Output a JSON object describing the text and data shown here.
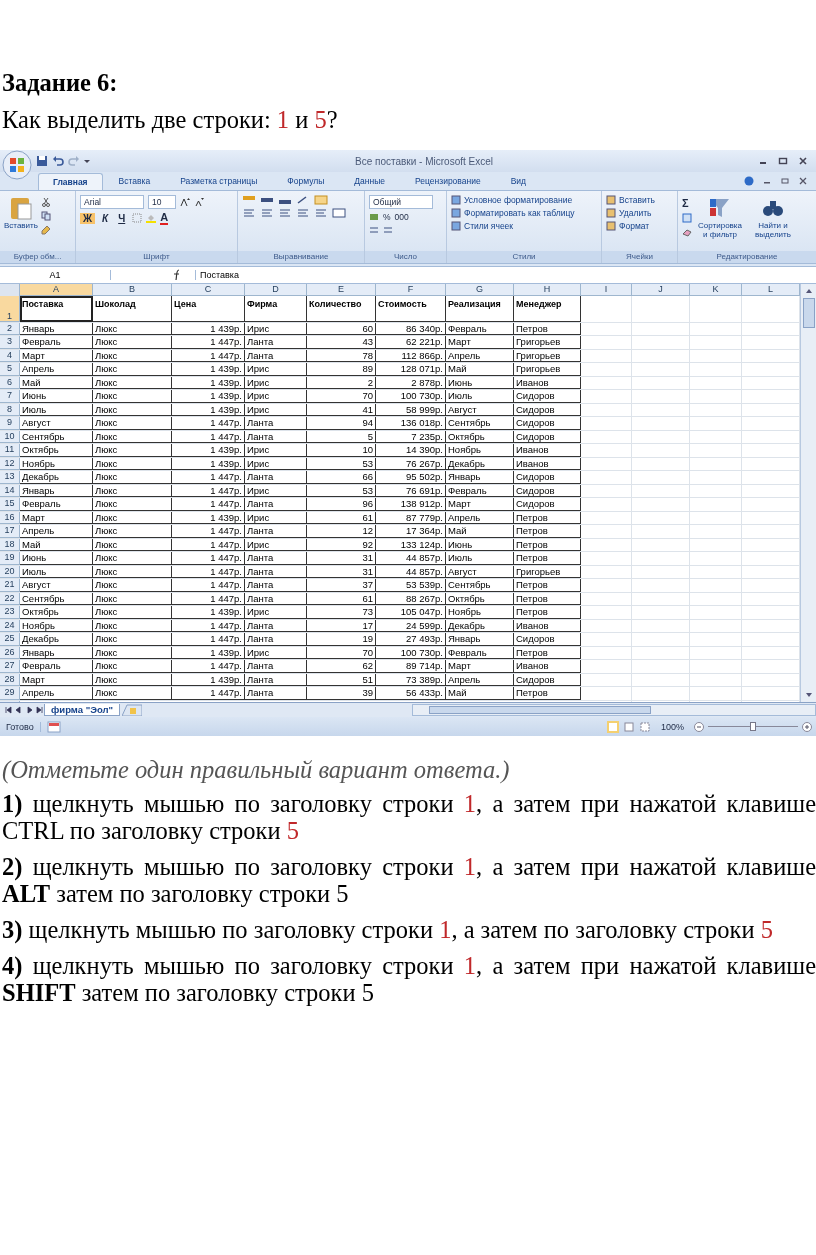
{
  "task": {
    "title": "Задание 6:",
    "question": [
      {
        "text": "Как выделить две строки: ",
        "accent": false
      },
      {
        "text": "1",
        "accent": true
      },
      {
        "text": " и ",
        "accent": false
      },
      {
        "text": "5",
        "accent": true
      },
      {
        "text": "?",
        "accent": false
      }
    ]
  },
  "excel": {
    "title": "Все поставки - Microsoft Excel",
    "tabs": [
      {
        "label": "Главная",
        "selected": true
      },
      {
        "label": "Вставка",
        "selected": false
      },
      {
        "label": "Разметка страницы",
        "selected": false
      },
      {
        "label": "Формулы",
        "selected": false
      },
      {
        "label": "Данные",
        "selected": false
      },
      {
        "label": "Рецензирование",
        "selected": false
      },
      {
        "label": "Вид",
        "selected": false
      }
    ],
    "ribbon": [
      {
        "kind": "clipboard",
        "label": "Буфер обм...",
        "paste": "Вставить"
      },
      {
        "kind": "font",
        "label": "Шрифт",
        "font": "Arial",
        "size": "10",
        "styles": [
          "Ж",
          "К",
          "Ч"
        ],
        "font_color": "A"
      },
      {
        "kind": "alignment",
        "label": "Выравнивание"
      },
      {
        "kind": "number",
        "label": "Число",
        "format": "Общий",
        "percent": "%",
        "thousands": "000"
      },
      {
        "kind": "styles",
        "label": "Стили",
        "items": [
          "Условное форматирование",
          "Форматировать как таблицу",
          "Стили ячеек"
        ]
      },
      {
        "kind": "cells",
        "label": "Ячейки",
        "items": [
          "Вставить",
          "Удалить",
          "Формат"
        ]
      },
      {
        "kind": "editing",
        "label": "Редактирование",
        "sum": "Σ",
        "sort": "Сортировка и фильтр",
        "find": "Найти и выделить"
      }
    ],
    "name_box": "A1",
    "formula": "Поставка",
    "columns": [
      {
        "letter": "A",
        "kind": "text",
        "selected": true
      },
      {
        "letter": "B",
        "kind": "text",
        "selected": false
      },
      {
        "letter": "C",
        "kind": "number",
        "selected": false
      },
      {
        "letter": "D",
        "kind": "text",
        "selected": false
      },
      {
        "letter": "E",
        "kind": "number",
        "selected": false
      },
      {
        "letter": "F",
        "kind": "number",
        "selected": false
      },
      {
        "letter": "G",
        "kind": "text",
        "selected": false
      },
      {
        "letter": "H",
        "kind": "text",
        "selected": false
      },
      {
        "letter": "I",
        "selected": false
      },
      {
        "letter": "J",
        "selected": false
      },
      {
        "letter": "K",
        "selected": false
      },
      {
        "letter": "L",
        "selected": false
      }
    ],
    "header_row": {
      "num": "1",
      "selected": true,
      "cells": [
        "Поставка",
        "Шоколад",
        "Цена",
        "Фирма",
        "Количество",
        "Стоимость",
        "Реализация",
        "Менеджер"
      ]
    },
    "rows": [
      {
        "num": "2",
        "cells": [
          "Январь",
          "Люкс",
          "1 439р.",
          "Ирис",
          "60",
          "86 340р.",
          "Февраль",
          "Петров"
        ]
      },
      {
        "num": "3",
        "cells": [
          "Февраль",
          "Люкс",
          "1 447р.",
          "Ланта",
          "43",
          "62 221р.",
          "Март",
          "Григорьев"
        ]
      },
      {
        "num": "4",
        "cells": [
          "Март",
          "Люкс",
          "1 447р.",
          "Ланта",
          "78",
          "112 866р.",
          "Апрель",
          "Григорьев"
        ]
      },
      {
        "num": "5",
        "cells": [
          "Апрель",
          "Люкс",
          "1 439р.",
          "Ирис",
          "89",
          "128 071р.",
          "Май",
          "Григорьев"
        ]
      },
      {
        "num": "6",
        "cells": [
          "Май",
          "Люкс",
          "1 439р.",
          "Ирис",
          "2",
          "2 878р.",
          "Июнь",
          "Иванов"
        ]
      },
      {
        "num": "7",
        "cells": [
          "Июнь",
          "Люкс",
          "1 439р.",
          "Ирис",
          "70",
          "100 730р.",
          "Июль",
          "Сидоров"
        ]
      },
      {
        "num": "8",
        "cells": [
          "Июль",
          "Люкс",
          "1 439р.",
          "Ирис",
          "41",
          "58 999р.",
          "Август",
          "Сидоров"
        ]
      },
      {
        "num": "9",
        "cells": [
          "Август",
          "Люкс",
          "1 447р.",
          "Ланта",
          "94",
          "136 018р.",
          "Сентябрь",
          "Сидоров"
        ]
      },
      {
        "num": "10",
        "cells": [
          "Сентябрь",
          "Люкс",
          "1 447р.",
          "Ланта",
          "5",
          "7 235р.",
          "Октябрь",
          "Сидоров"
        ]
      },
      {
        "num": "11",
        "cells": [
          "Октябрь",
          "Люкс",
          "1 439р.",
          "Ирис",
          "10",
          "14 390р.",
          "Ноябрь",
          "Иванов"
        ]
      },
      {
        "num": "12",
        "cells": [
          "Ноябрь",
          "Люкс",
          "1 439р.",
          "Ирис",
          "53",
          "76 267р.",
          "Декабрь",
          "Иванов"
        ]
      },
      {
        "num": "13",
        "cells": [
          "Декабрь",
          "Люкс",
          "1 447р.",
          "Ланта",
          "66",
          "95 502р.",
          "Январь",
          "Сидоров"
        ]
      },
      {
        "num": "14",
        "cells": [
          "Январь",
          "Люкс",
          "1 447р.",
          "Ирис",
          "53",
          "76 691р.",
          "Февраль",
          "Сидоров"
        ]
      },
      {
        "num": "15",
        "cells": [
          "Февраль",
          "Люкс",
          "1 447р.",
          "Ланта",
          "96",
          "138 912р.",
          "Март",
          "Сидоров"
        ]
      },
      {
        "num": "16",
        "cells": [
          "Март",
          "Люкс",
          "1 439р.",
          "Ирис",
          "61",
          "87 779р.",
          "Апрель",
          "Петров"
        ]
      },
      {
        "num": "17",
        "cells": [
          "Апрель",
          "Люкс",
          "1 447р.",
          "Ланта",
          "12",
          "17 364р.",
          "Май",
          "Петров"
        ]
      },
      {
        "num": "18",
        "cells": [
          "Май",
          "Люкс",
          "1 447р.",
          "Ирис",
          "92",
          "133 124р.",
          "Июнь",
          "Петров"
        ]
      },
      {
        "num": "19",
        "cells": [
          "Июнь",
          "Люкс",
          "1 447р.",
          "Ланта",
          "31",
          "44 857р.",
          "Июль",
          "Петров"
        ]
      },
      {
        "num": "20",
        "cells": [
          "Июль",
          "Люкс",
          "1 447р.",
          "Ланта",
          "31",
          "44 857р.",
          "Август",
          "Григорьев"
        ]
      },
      {
        "num": "21",
        "cells": [
          "Август",
          "Люкс",
          "1 447р.",
          "Ланта",
          "37",
          "53 539р.",
          "Сентябрь",
          "Петров"
        ]
      },
      {
        "num": "22",
        "cells": [
          "Сентябрь",
          "Люкс",
          "1 447р.",
          "Ланта",
          "61",
          "88 267р.",
          "Октябрь",
          "Петров"
        ]
      },
      {
        "num": "23",
        "cells": [
          "Октябрь",
          "Люкс",
          "1 439р.",
          "Ирис",
          "73",
          "105 047р.",
          "Ноябрь",
          "Петров"
        ]
      },
      {
        "num": "24",
        "cells": [
          "Ноябрь",
          "Люкс",
          "1 447р.",
          "Ланта",
          "17",
          "24 599р.",
          "Декабрь",
          "Иванов"
        ]
      },
      {
        "num": "25",
        "cells": [
          "Декабрь",
          "Люкс",
          "1 447р.",
          "Ланта",
          "19",
          "27 493р.",
          "Январь",
          "Сидоров"
        ]
      },
      {
        "num": "26",
        "cells": [
          "Январь",
          "Люкс",
          "1 439р.",
          "Ирис",
          "70",
          "100 730р.",
          "Февраль",
          "Петров"
        ]
      },
      {
        "num": "27",
        "cells": [
          "Февраль",
          "Люкс",
          "1 447р.",
          "Ланта",
          "62",
          "89 714р.",
          "Март",
          "Иванов"
        ]
      },
      {
        "num": "28",
        "cells": [
          "Март",
          "Люкс",
          "1 439р.",
          "Ланта",
          "51",
          "73 389р.",
          "Апрель",
          "Сидоров"
        ]
      },
      {
        "num": "29",
        "cells": [
          "Апрель",
          "Люкс",
          "1 447р.",
          "Ланта",
          "39",
          "56 433р.",
          "Май",
          "Петров"
        ]
      }
    ],
    "sheet_tab": "фирма \"Эол\"",
    "status": "Готово",
    "zoom": "100%",
    "zoom_slider": {
      "level": 0.5
    }
  },
  "instruction": "(Отметьте один правильный вариант ответа.)",
  "answers": [
    {
      "number": "1)",
      "parts": [
        {
          "text": "щелкнуть мышью по заголовку строки ",
          "accent": false
        },
        {
          "text": "1",
          "accent": true
        },
        {
          "text": ", а затем при нажатой клавише CTRL по заголовку строки ",
          "accent": false
        },
        {
          "text": "5",
          "accent": true
        }
      ]
    },
    {
      "number": "2)",
      "parts": [
        {
          "text": "щелкнуть мышью по заголовку строки ",
          "accent": false
        },
        {
          "text": "1",
          "accent": true
        },
        {
          "text": ", а затем при нажатой клавише **ALT** затем по заголовку строки 5",
          "accent": false
        }
      ]
    },
    {
      "number": "3)",
      "parts": [
        {
          "text": "щелкнуть мышью по заголовку строки ",
          "accent": false
        },
        {
          "text": "1",
          "accent": true
        },
        {
          "text": ", а затем по заголовку строки ",
          "accent": false
        },
        {
          "text": "5",
          "accent": true
        }
      ]
    },
    {
      "number": "4)",
      "parts": [
        {
          "text": "щелкнуть мышью по заголовку строки ",
          "accent": false
        },
        {
          "text": "1",
          "accent": true
        },
        {
          "text": ", а затем при нажатой клавише **SHIFT** затем по заголовку строки 5",
          "accent": false
        }
      ]
    }
  ]
}
